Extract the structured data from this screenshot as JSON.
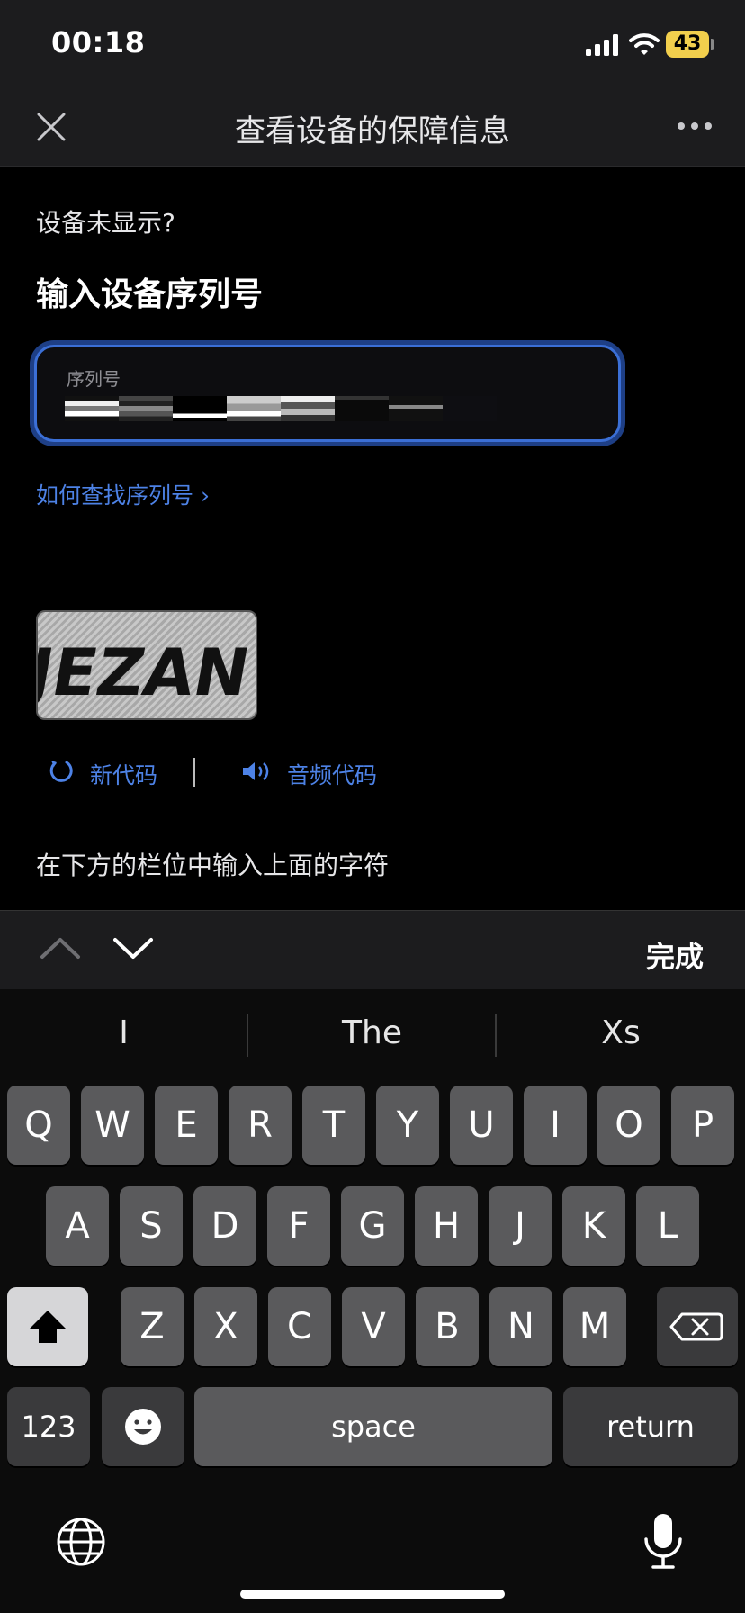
{
  "status_bar": {
    "time": "00:18",
    "battery": "43"
  },
  "nav": {
    "title": "查看设备的保障信息"
  },
  "content": {
    "missing_device": "设备未显示?",
    "serial_heading": "输入设备序列号",
    "serial_label": "序列号",
    "find_serial_link": "如何查找序列号 ›",
    "captcha_text": "JEZAN",
    "new_code": "新代码",
    "audio_code": "音频代码",
    "captcha_instruction": "在下方的栏位中输入上面的字符"
  },
  "accessory": {
    "done": "完成"
  },
  "keyboard": {
    "suggestions": [
      "I",
      "The",
      "Xs"
    ],
    "row1": [
      "Q",
      "W",
      "E",
      "R",
      "T",
      "Y",
      "U",
      "I",
      "O",
      "P"
    ],
    "row2": [
      "A",
      "S",
      "D",
      "F",
      "G",
      "H",
      "J",
      "K",
      "L"
    ],
    "row3": [
      "Z",
      "X",
      "C",
      "V",
      "B",
      "N",
      "M"
    ],
    "numbers_key": "123",
    "space_key": "space",
    "return_key": "return"
  },
  "colors": {
    "accent": "#4d82e6",
    "focus_ring": "#3b6fd6",
    "battery": "#f2cf4d"
  }
}
